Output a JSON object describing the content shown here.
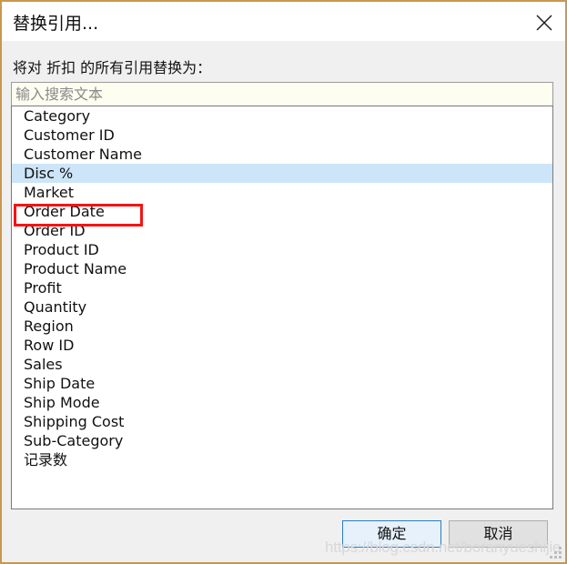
{
  "window": {
    "title": "替换引用...",
    "border_color": "#c8974f",
    "close_icon": "close-icon"
  },
  "dialog": {
    "prompt_label": "将对 折扣 的所有引用替换为：",
    "search": {
      "placeholder": "输入搜索文本",
      "value": "",
      "background_color": "#fdfdf0"
    },
    "list": {
      "selected_index": 3,
      "selection_color": "#cde5f8",
      "items": [
        {
          "label": "Category"
        },
        {
          "label": "Customer ID"
        },
        {
          "label": "Customer Name"
        },
        {
          "label": "Disc %"
        },
        {
          "label": "Market"
        },
        {
          "label": "Order Date"
        },
        {
          "label": "Order ID"
        },
        {
          "label": "Product ID"
        },
        {
          "label": "Product Name"
        },
        {
          "label": "Profit"
        },
        {
          "label": "Quantity"
        },
        {
          "label": "Region"
        },
        {
          "label": "Row ID"
        },
        {
          "label": "Sales"
        },
        {
          "label": "Ship Date"
        },
        {
          "label": "Ship Mode"
        },
        {
          "label": "Shipping Cost"
        },
        {
          "label": "Sub-Category"
        },
        {
          "label": "记录数"
        }
      ]
    },
    "annotation": {
      "color": "#f41414",
      "target_label": "Disc %"
    },
    "buttons": {
      "ok_label": "确定",
      "cancel_label": "取消",
      "ok_accent_color": "#2b7cbf"
    }
  },
  "watermark": {
    "text": "https://blog.csdn.net/boranyueshijie"
  }
}
